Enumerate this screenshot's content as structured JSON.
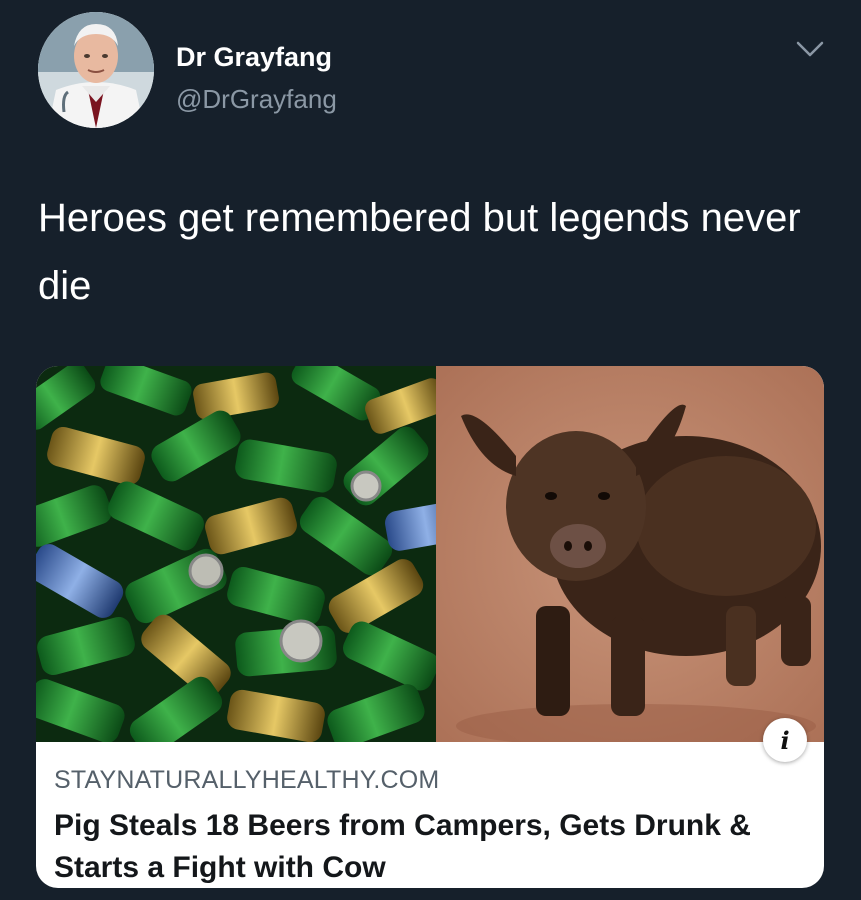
{
  "author": {
    "display_name": "Dr Grayfang",
    "handle": "@DrGrayfang",
    "avatar_icon": "avatar-photo"
  },
  "header": {
    "more_icon": "chevron-down-icon"
  },
  "tweet": {
    "text": "Heroes get remembered but legends never die"
  },
  "card": {
    "domain": "STAYNATURALLYHEALTHY.COM",
    "headline": "Pig Steals 18 Beers from Campers, Gets Drunk & Starts a Fight with Cow",
    "info_icon": "info-icon",
    "info_glyph": "i",
    "left_image": "beer-cans-image",
    "right_image": "pig-image"
  },
  "colors": {
    "background": "#16202b",
    "text": "#ffffff",
    "secondary_text": "#8b98a5",
    "card_bg": "#ffffff",
    "headline": "#14171a",
    "domain": "#55606a"
  }
}
